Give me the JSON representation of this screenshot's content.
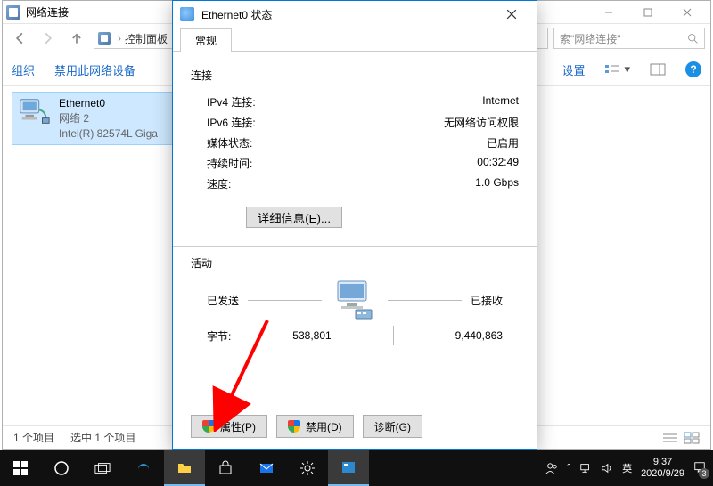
{
  "explorer": {
    "title": "网络连接",
    "address_segments": [
      "控制面板"
    ],
    "search_placeholder": "索\"网络连接\"",
    "toolbar": {
      "organize": "组织",
      "disable": "禁用此网络设备",
      "right_label": "设置"
    },
    "item": {
      "name": "Ethernet0",
      "network": "网络 2",
      "adapter": "Intel(R) 82574L Giga"
    },
    "status_left_1": "1 个项目",
    "status_left_2": "选中 1 个项目"
  },
  "dialog": {
    "title": "Ethernet0 状态",
    "tab": "常规",
    "section_conn": "连接",
    "ipv4_label": "IPv4 连接:",
    "ipv4_value": "Internet",
    "ipv6_label": "IPv6 连接:",
    "ipv6_value": "无网络访问权限",
    "media_label": "媒体状态:",
    "media_value": "已启用",
    "duration_label": "持续时间:",
    "duration_value": "00:32:49",
    "speed_label": "速度:",
    "speed_value": "1.0 Gbps",
    "details_btn": "详细信息(E)...",
    "section_activity": "活动",
    "sent_label": "已发送",
    "recv_label": "已接收",
    "bytes_label": "字节:",
    "bytes_sent": "538,801",
    "bytes_recv": "9,440,863",
    "btn_props": "属性(P)",
    "btn_disable": "禁用(D)",
    "btn_diag": "诊断(G)"
  },
  "taskbar": {
    "ime": "英",
    "time": "9:37",
    "date": "2020/9/29",
    "notif_count": "3"
  }
}
